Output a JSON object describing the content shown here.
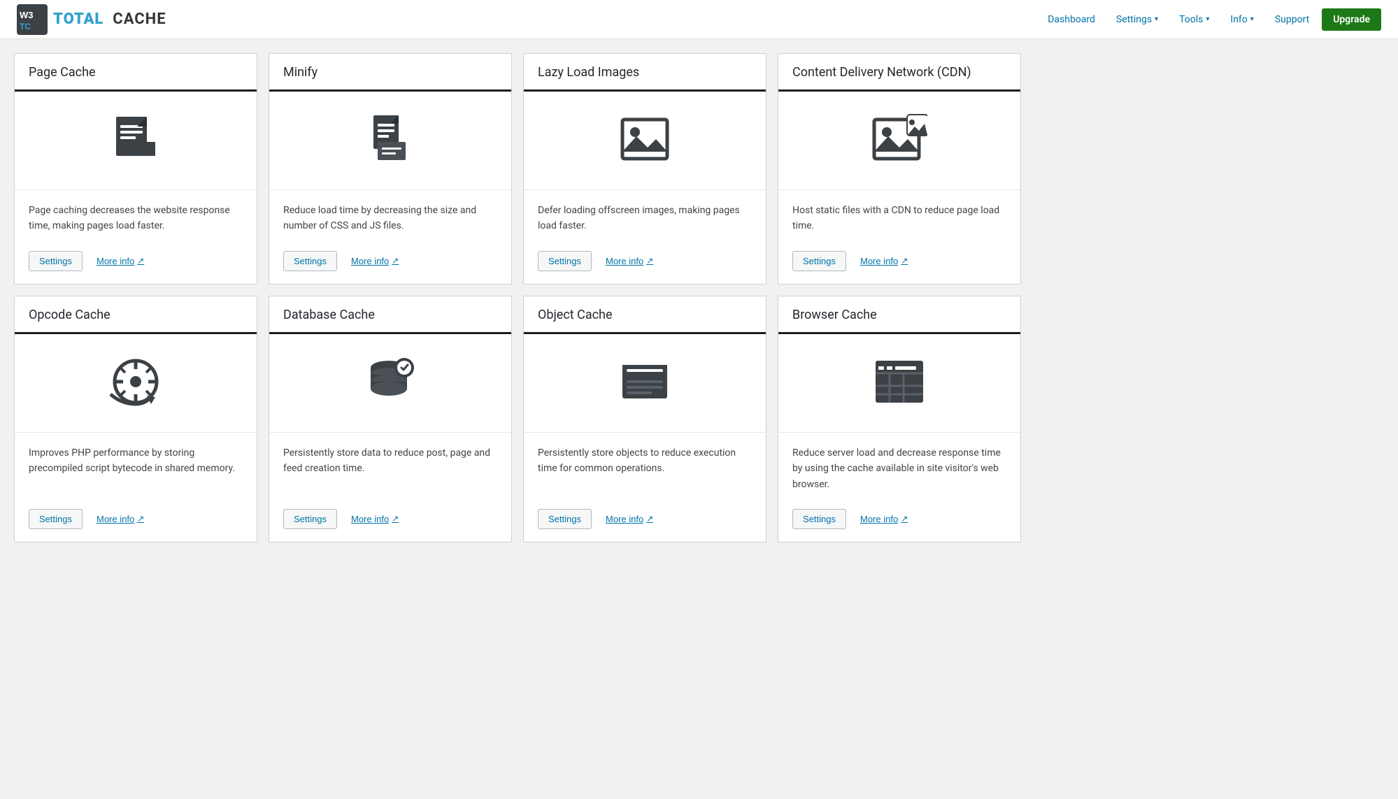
{
  "header": {
    "logo_w3": "W3",
    "logo_total": "TOTAL",
    "logo_cache": "CACHE",
    "nav": [
      {
        "id": "dashboard",
        "label": "Dashboard",
        "has_dropdown": false
      },
      {
        "id": "settings",
        "label": "Settings",
        "has_dropdown": true
      },
      {
        "id": "tools",
        "label": "Tools",
        "has_dropdown": true
      },
      {
        "id": "info",
        "label": "Info",
        "has_dropdown": true
      },
      {
        "id": "support",
        "label": "Support",
        "has_dropdown": false
      }
    ],
    "upgrade_label": "Upgrade"
  },
  "cards": [
    {
      "id": "page-cache",
      "title": "Page Cache",
      "description": "Page caching decreases the website response time, making pages load faster.",
      "icon": "page",
      "settings_label": "Settings",
      "more_info_label": "More info"
    },
    {
      "id": "minify",
      "title": "Minify",
      "description": "Reduce load time by decreasing the size and number of CSS and JS files.",
      "icon": "minify",
      "settings_label": "Settings",
      "more_info_label": "More info"
    },
    {
      "id": "lazy-load",
      "title": "Lazy Load Images",
      "description": "Defer loading offscreen images, making pages load faster.",
      "icon": "image",
      "settings_label": "Settings",
      "more_info_label": "More info"
    },
    {
      "id": "cdn",
      "title": "Content Delivery Network (CDN)",
      "description": "Host static files with a CDN to reduce page load time.",
      "icon": "cdn",
      "settings_label": "Settings",
      "more_info_label": "More info"
    },
    {
      "id": "opcode-cache",
      "title": "Opcode Cache",
      "description": "Improves PHP performance by storing precompiled script bytecode in shared memory.",
      "icon": "opcode",
      "settings_label": "Settings",
      "more_info_label": "More info"
    },
    {
      "id": "database-cache",
      "title": "Database Cache",
      "description": "Persistently store data to reduce post, page and feed creation time.",
      "icon": "database",
      "settings_label": "Settings",
      "more_info_label": "More info"
    },
    {
      "id": "object-cache",
      "title": "Object Cache",
      "description": "Persistently store objects to reduce execution time for common operations.",
      "icon": "object",
      "settings_label": "Settings",
      "more_info_label": "More info"
    },
    {
      "id": "browser-cache",
      "title": "Browser Cache",
      "description": "Reduce server load and decrease response time by using the cache available in site visitor's web browser.",
      "icon": "browser",
      "settings_label": "Settings",
      "more_info_label": "More info"
    }
  ]
}
